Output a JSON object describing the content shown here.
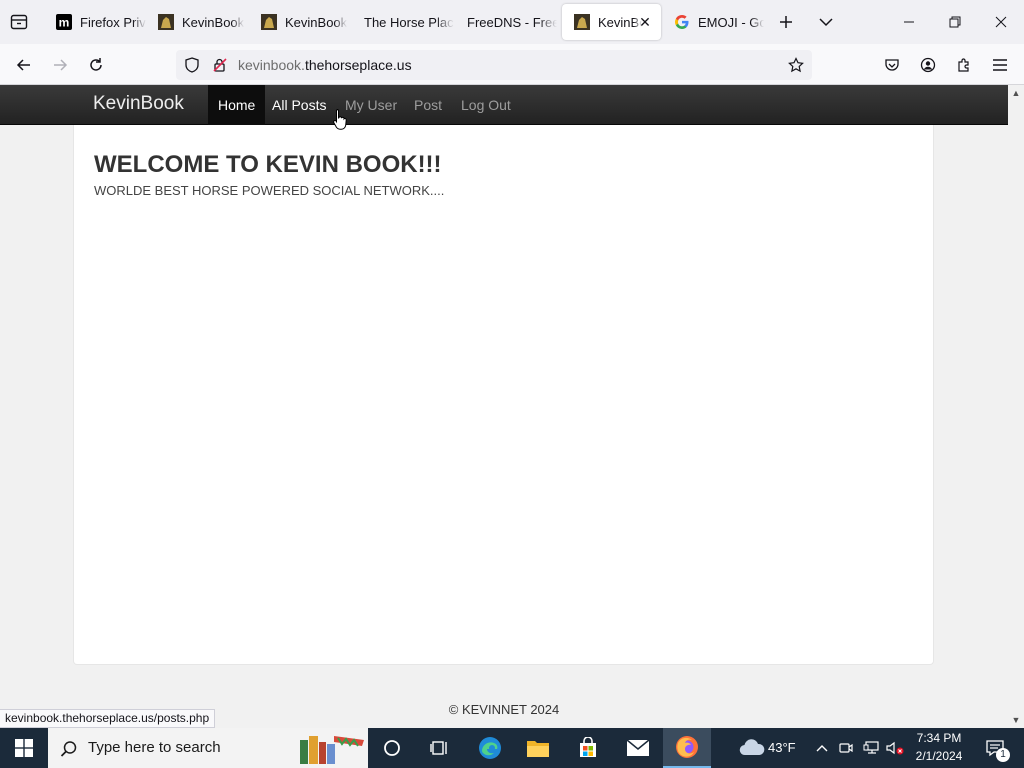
{
  "browser": {
    "tabs": [
      {
        "title": "Firefox Priv",
        "favicon": "mozilla-m-icon",
        "active": false
      },
      {
        "title": "KevinBook",
        "favicon": "horse-photo-icon",
        "active": false
      },
      {
        "title": "KevinBook",
        "favicon": "horse-photo-icon",
        "active": false
      },
      {
        "title": "The Horse Plac",
        "favicon": "",
        "active": false
      },
      {
        "title": "FreeDNS - Free",
        "favicon": "",
        "active": false
      },
      {
        "title": "KevinBo",
        "favicon": "horse-photo-icon",
        "active": true
      },
      {
        "title": "EMOJI - Go",
        "favicon": "google-icon",
        "active": false
      }
    ],
    "url": {
      "domain_prefix": "kevinbook.",
      "domain_main": "thehorseplace.us"
    },
    "status_url": "kevinbook.thehorseplace.us/posts.php"
  },
  "site": {
    "brand": "KevinBook",
    "nav": [
      {
        "label": "Home",
        "state": "active"
      },
      {
        "label": "All Posts",
        "state": "hover"
      },
      {
        "label": "My User",
        "state": "normal"
      },
      {
        "label": "Post",
        "state": "normal"
      },
      {
        "label": "Log Out",
        "state": "normal"
      }
    ],
    "heading": "WELCOME TO KEVIN BOOK!!!",
    "tagline": "WORLDE BEST HORSE POWERED SOCIAL NETWORK....",
    "footer": "© KEVINNET 2024"
  },
  "taskbar": {
    "search_placeholder": "Type here to search",
    "weather": "43°F",
    "time": "7:34 PM",
    "date": "2/1/2024",
    "notification_count": "1"
  },
  "colors": {
    "site_nav_bg": "#222222",
    "taskbar_bg": "#1b2a3a",
    "firefox_orange": "#ff7139"
  }
}
